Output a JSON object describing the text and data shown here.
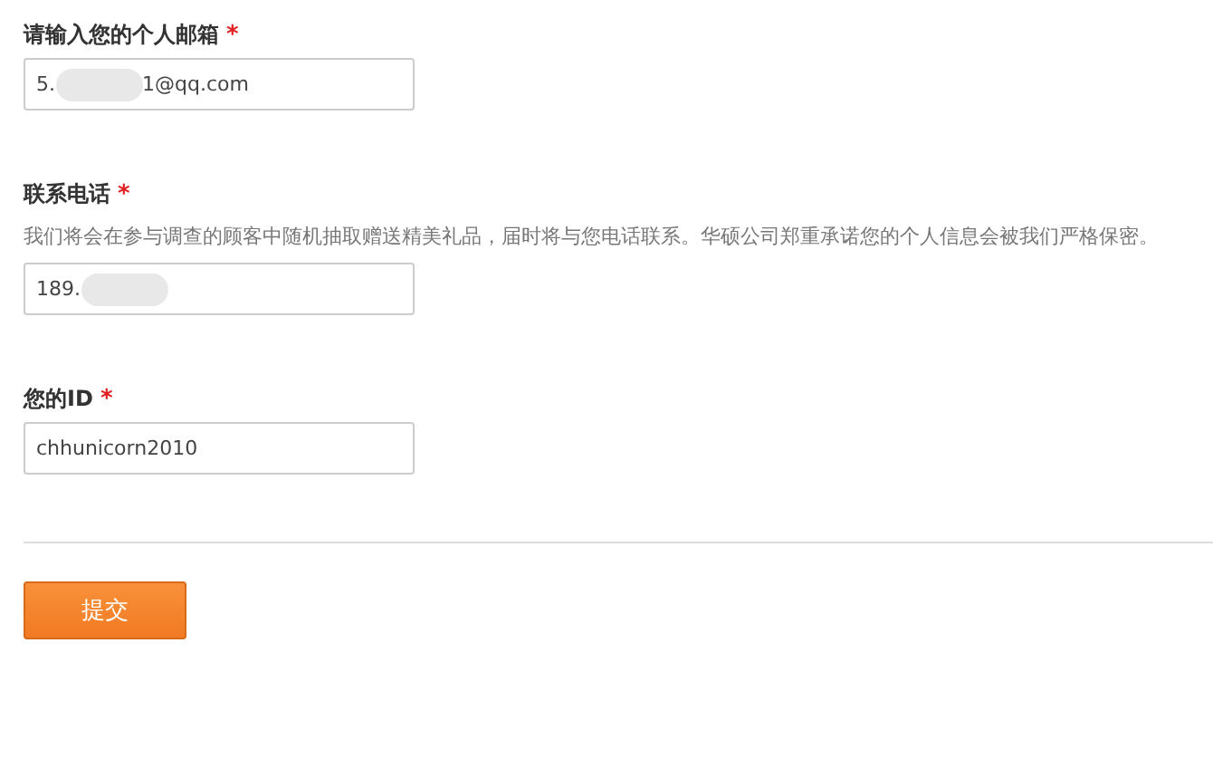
{
  "fields": [
    {
      "label": "请输入您的个人邮箱",
      "required_mark": "*",
      "value": [
        {
          "kind": "text",
          "text": "5."
        },
        {
          "kind": "redacted"
        },
        {
          "kind": "text",
          "text": "1@qq.com"
        }
      ]
    },
    {
      "label": "联系电话",
      "required_mark": "*",
      "hint": "我们将会在参与调查的顾客中随机抽取赠送精美礼品，届时将与您电话联系。华硕公司郑重承诺您的个人信息会被我们严格保密。",
      "value": [
        {
          "kind": "text",
          "text": "189."
        },
        {
          "kind": "redacted"
        }
      ]
    },
    {
      "label": "您的ID",
      "required_mark": "*",
      "value": [
        {
          "kind": "text",
          "text": "chhunicorn2010"
        }
      ]
    }
  ],
  "submit_button": "提交"
}
